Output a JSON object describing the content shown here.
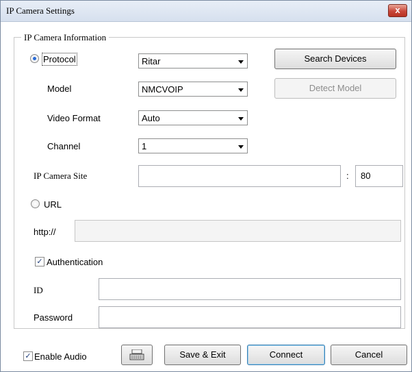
{
  "window": {
    "title": "IP Camera Settings",
    "close_label": "x"
  },
  "group": {
    "title": "IP Camera Information"
  },
  "protocol": {
    "label": "Protocol",
    "selected": true,
    "value": "Ritar"
  },
  "search_devices_label": "Search Devices",
  "model": {
    "label": "Model",
    "value": "NMCVOIP"
  },
  "detect_model_label": "Detect Model",
  "video_format": {
    "label": "Video Format",
    "value": "Auto"
  },
  "channel": {
    "label": "Channel",
    "value": "1"
  },
  "ip_site": {
    "label": "IP Camera Site",
    "value": "",
    "port_separator": ":",
    "port": "80"
  },
  "url": {
    "label": "URL",
    "selected": false,
    "prefix": "http://",
    "value": ""
  },
  "authentication": {
    "label": "Authentication",
    "checked": true
  },
  "id_field": {
    "label": "ID",
    "value": ""
  },
  "password_field": {
    "label": "Password",
    "value": ""
  },
  "footer": {
    "enable_audio_label": "Enable Audio",
    "enable_audio_checked": true,
    "keyboard_icon": "keyboard-icon",
    "save_exit_label": "Save & Exit",
    "connect_label": "Connect",
    "cancel_label": "Cancel"
  }
}
